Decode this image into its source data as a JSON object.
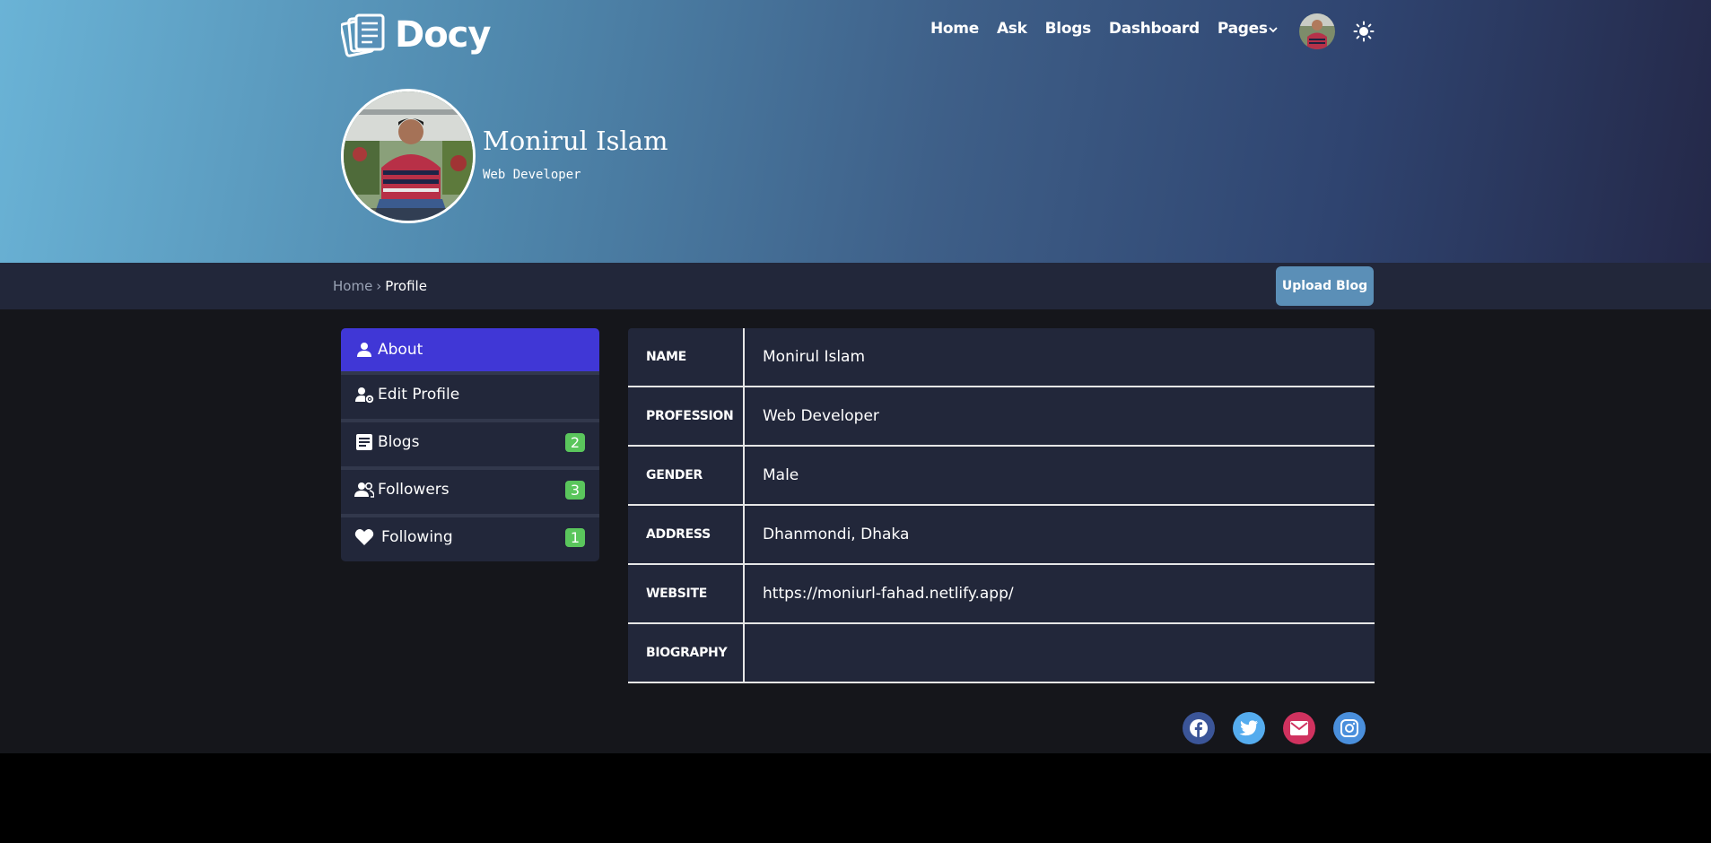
{
  "brand": {
    "name": "Docy"
  },
  "nav": {
    "items": [
      "Home",
      "Ask",
      "Blogs",
      "Dashboard",
      "Pages"
    ]
  },
  "profile": {
    "name": "Monirul Islam",
    "role": "Web Developer"
  },
  "breadcrumb": {
    "home": "Home",
    "separator": "›",
    "current": "Profile"
  },
  "actions": {
    "upload_label": "Upload Blog"
  },
  "sidebar": {
    "items": [
      {
        "label": "About",
        "icon": "person-icon",
        "active": true
      },
      {
        "label": "Edit Profile",
        "icon": "user-settings-icon"
      },
      {
        "label": "Blogs",
        "icon": "article-icon",
        "badge": "2"
      },
      {
        "label": "Followers",
        "icon": "people-icon",
        "badge": "3"
      },
      {
        "label": "Following",
        "icon": "heart-icon",
        "badge": "1"
      }
    ]
  },
  "details": {
    "rows": [
      {
        "key": "NAME",
        "value": "Monirul Islam"
      },
      {
        "key": "PROFESSION",
        "value": "Web Developer"
      },
      {
        "key": "GENDER",
        "value": "Male"
      },
      {
        "key": "ADDRESS",
        "value": "Dhanmondi, Dhaka"
      },
      {
        "key": "WEBSITE",
        "value": "https://moniurl-fahad.netlify.app/"
      },
      {
        "key": "BIOGRAPHY",
        "value": ""
      }
    ]
  },
  "colors": {
    "accent": "#4037d6",
    "badge": "#5ac65c",
    "upload_button": "#5b8fb7"
  },
  "socials": [
    "facebook-icon",
    "twitter-icon",
    "email-icon",
    "instagram-icon"
  ]
}
